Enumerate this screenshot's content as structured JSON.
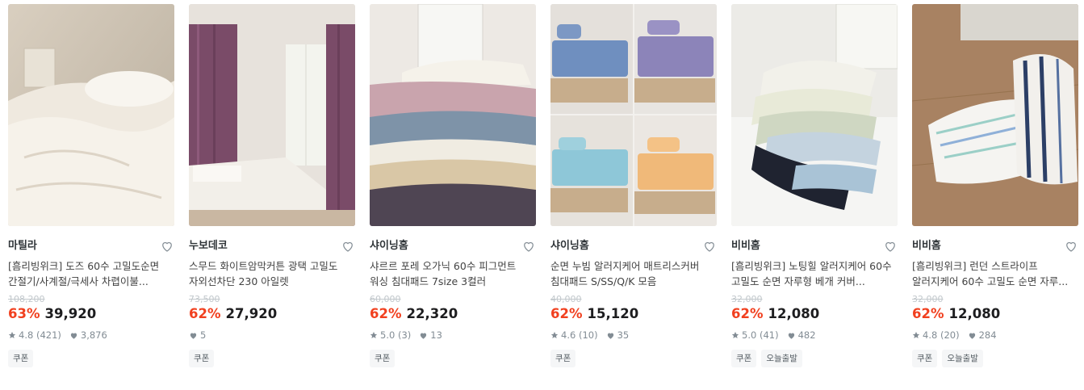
{
  "products": [
    {
      "brand": "마틸라",
      "title": "[흠리빙위크] 도즈 60수 고밀도순면 간절기/사계절/극세사 차렵이불...",
      "original_price": "108,200",
      "discount": "63%",
      "price": "39,920",
      "rating": "4.8",
      "reviews": "(421)",
      "likes": "3,876",
      "badges": [
        "쿠폰"
      ]
    },
    {
      "brand": "누보데코",
      "title": "스무드 화이트암막커튼 광택 고밀도 자외선차단 230 아일렛",
      "original_price": "73,500",
      "discount": "62%",
      "price": "27,920",
      "rating": "",
      "reviews": "",
      "likes": "5",
      "badges": [
        "쿠폰"
      ]
    },
    {
      "brand": "샤이닝홈",
      "title": "샤르르 포레 오가닉 60수 피그먼트 워싱 침대패드 7size 3컬러",
      "original_price": "60,000",
      "discount": "62%",
      "price": "22,320",
      "rating": "5.0",
      "reviews": "(3)",
      "likes": "13",
      "badges": [
        "쿠폰"
      ]
    },
    {
      "brand": "샤이닝홈",
      "title": "순면 누빔 알러지케어 매트리스커버 침대패드 S/SS/Q/K 모음",
      "original_price": "40,000",
      "discount": "62%",
      "price": "15,120",
      "rating": "4.6",
      "reviews": "(10)",
      "likes": "35",
      "badges": [
        "쿠폰"
      ]
    },
    {
      "brand": "비비홈",
      "title": "[흠리빙위크] 노팅힐 알러지케어 60수 고밀도 순면 자루형 베개 커버...",
      "original_price": "32,000",
      "discount": "62%",
      "price": "12,080",
      "rating": "5.0",
      "reviews": "(41)",
      "likes": "482",
      "badges": [
        "쿠폰",
        "오늘출발"
      ]
    },
    {
      "brand": "비비홈",
      "title": "[흠리빙위크] 런던 스트라이프 알러지케어 60수 고밀도 순면 자루...",
      "original_price": "32,000",
      "discount": "62%",
      "price": "12,080",
      "rating": "4.8",
      "reviews": "(20)",
      "likes": "284",
      "badges": [
        "쿠폰",
        "오늘출발"
      ]
    }
  ],
  "icons": {
    "wish": "heart-outline-icon",
    "star": "star-icon",
    "like": "heart-icon"
  },
  "colors": {
    "discount": "#f1401f",
    "price": "#1d1d1f",
    "muted": "#828c94",
    "badge_bg": "#f5f6f7"
  }
}
